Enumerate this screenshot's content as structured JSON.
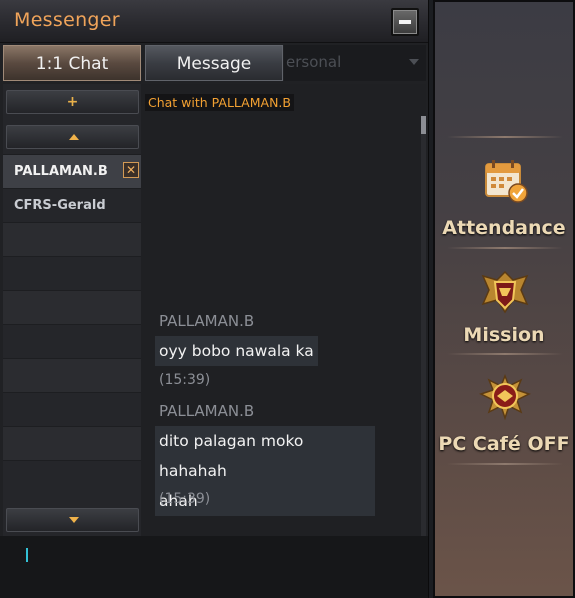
{
  "window": {
    "title": "Messenger"
  },
  "tabs": [
    {
      "label": "1:1 Chat",
      "active": true
    },
    {
      "label": "Message",
      "active": false
    }
  ],
  "background_hint": {
    "text": "ersonal"
  },
  "contacts": {
    "add_label": "+",
    "items": [
      {
        "name": "PALLAMAN.B",
        "selected": true,
        "color": "#f2f2f2"
      },
      {
        "name": "CFRS-Gerald",
        "selected": false,
        "color": "#c9ccd2"
      }
    ]
  },
  "chat": {
    "header": "Chat with PALLAMAN.B",
    "messages": [
      {
        "sender": "PALLAMAN.B",
        "lines": [
          "oyy bobo nawala ka"
        ],
        "time": "(15:39)"
      },
      {
        "sender": "PALLAMAN.B",
        "lines": [
          "dito palagan moko hahahah",
          "ahah"
        ],
        "time": "(15:39)"
      }
    ]
  },
  "sidebar": {
    "items": [
      {
        "label": "Attendance",
        "icon": "calendar-check-icon"
      },
      {
        "label": "Mission",
        "icon": "mission-emblem-icon"
      },
      {
        "label": "PC Café OFF",
        "icon": "pc-cafe-emblem-icon"
      }
    ]
  },
  "colors": {
    "title": "#f0a45a",
    "chat_header": "#f3a132",
    "accent": "#f0b24a",
    "caret": "#33c1d6"
  }
}
